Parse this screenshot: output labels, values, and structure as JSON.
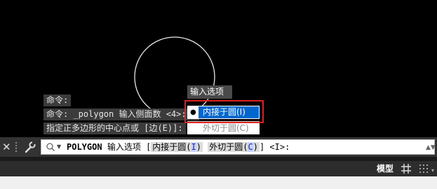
{
  "history": [
    {
      "text": "命令:"
    },
    {
      "text": "命令: _polygon 输入侧面数 <4>: 6"
    },
    {
      "text": "指定正多边形的中心点或 [边(E)]:"
    }
  ],
  "popup": {
    "title": "输入选项",
    "options": [
      {
        "label": "内接于圆(I)",
        "selected": true
      },
      {
        "label": "外切于圆(C)",
        "selected": false
      }
    ]
  },
  "command_line": {
    "command": "POLYGON",
    "prompt": "输入选项",
    "open_bracket": "[",
    "option1_text": "内接于圆(",
    "option1_key": "I",
    "option2_text": "外切于圆(",
    "option2_key": "C",
    "close_paren": ")",
    "close_bracket": "]",
    "default": "<I>:"
  },
  "status": {
    "model_label": "模型"
  },
  "colors": {
    "canvas": "#000000",
    "highlight": "#0066cc",
    "callout": "#e02020"
  }
}
